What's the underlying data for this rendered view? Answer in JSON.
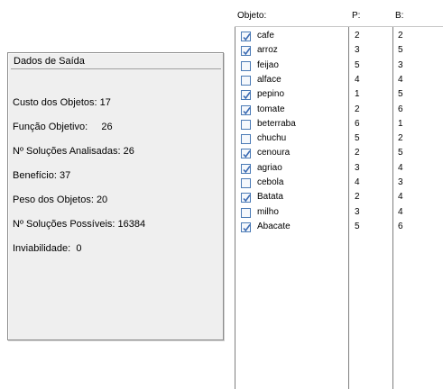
{
  "output_panel": {
    "title": "Dados de Saída",
    "rows": [
      "Custo dos Objetos: 17",
      "Função Objetivo:     26",
      "Nº Soluções Analisadas: 26",
      "Benefício: 37",
      "Peso dos Objetos: 20",
      "Nº Soluções Possíveis: 16384",
      "Inviabilidade:  0"
    ]
  },
  "table": {
    "headers": {
      "object": "Objeto:",
      "p": "P:",
      "b": "B:"
    },
    "rows": [
      {
        "name": "cafe",
        "checked": true,
        "p": "2",
        "b": "2"
      },
      {
        "name": "arroz",
        "checked": true,
        "p": "3",
        "b": "5"
      },
      {
        "name": "feijao",
        "checked": false,
        "p": "5",
        "b": "3"
      },
      {
        "name": "alface",
        "checked": false,
        "p": "4",
        "b": "4"
      },
      {
        "name": "pepino",
        "checked": true,
        "p": "1",
        "b": "5"
      },
      {
        "name": "tomate",
        "checked": true,
        "p": "2",
        "b": "6"
      },
      {
        "name": "beterraba",
        "checked": false,
        "p": "6",
        "b": "1"
      },
      {
        "name": "chuchu",
        "checked": false,
        "p": "5",
        "b": "2"
      },
      {
        "name": "cenoura",
        "checked": true,
        "p": "2",
        "b": "5"
      },
      {
        "name": "agriao",
        "checked": true,
        "p": "3",
        "b": "4"
      },
      {
        "name": "cebola",
        "checked": false,
        "p": "4",
        "b": "3"
      },
      {
        "name": "Batata",
        "checked": true,
        "p": "2",
        "b": "4"
      },
      {
        "name": "milho",
        "checked": false,
        "p": "3",
        "b": "4"
      },
      {
        "name": "Abacate",
        "checked": true,
        "p": "5",
        "b": "6"
      }
    ]
  },
  "colors": {
    "check": "#3b6bb3",
    "checkbox_border": "#4a7ab5",
    "panel_bg": "#efefef"
  }
}
